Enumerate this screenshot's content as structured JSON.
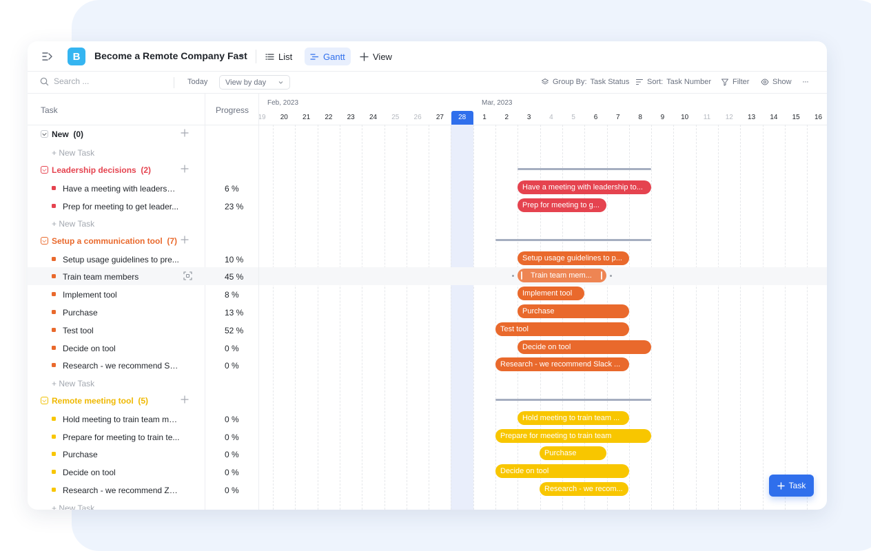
{
  "header": {
    "project_initial": "B",
    "project_title": "Become a Remote Company Fast",
    "views": {
      "list": "List",
      "gantt": "Gantt",
      "add": "View"
    }
  },
  "toolbar": {
    "search_placeholder": "Search ...",
    "today": "Today",
    "view_by": "View by day",
    "group_by_label": "Group By:",
    "group_by_value": "Task Status",
    "sort_label": "Sort:",
    "sort_value": "Task Number",
    "filter": "Filter",
    "show": "Show",
    "more": "···"
  },
  "columns": {
    "task": "Task",
    "progress": "Progress"
  },
  "timeline": {
    "months": [
      "Feb, 2023",
      "Mar, 2023"
    ],
    "days": [
      "19",
      "20",
      "21",
      "22",
      "23",
      "24",
      "25",
      "26",
      "27",
      "28",
      "1",
      "2",
      "3",
      "4",
      "5",
      "6",
      "7",
      "8",
      "9",
      "10",
      "11",
      "12",
      "13",
      "14",
      "15",
      "16"
    ],
    "weekend_days": [
      "19",
      "25",
      "26",
      "4",
      "5",
      "11",
      "12"
    ],
    "today": "28"
  },
  "colors": {
    "red": "#e5434f",
    "orange": "#e9692c",
    "yellow": "#f8c600",
    "today": "#2f6fec"
  },
  "groups": {
    "new": {
      "name": "New",
      "count": "(0)",
      "new_task": "+ New Task"
    },
    "leadership": {
      "name": "Leadership decisions",
      "count": "(2)",
      "new_task": "+ New Task",
      "tasks": [
        {
          "name": "Have a meeting with leadershi...",
          "progress": "6 %",
          "bar": "Have a meeting with leadership to..."
        },
        {
          "name": "Prep for meeting to get leader...",
          "progress": "23 %",
          "bar": "Prep for meeting to g..."
        }
      ]
    },
    "setup": {
      "name": "Setup a communication tool",
      "count": "(7)",
      "new_task": "+ New Task",
      "tasks": [
        {
          "name": "Setup usage guidelines to pre...",
          "progress": "10 %",
          "bar": "Setup usage guidelines to p..."
        },
        {
          "name": "Train team members",
          "progress": "45 %",
          "bar": "Train team mem..."
        },
        {
          "name": "Implement tool",
          "progress": "8 %",
          "bar": "Implement tool"
        },
        {
          "name": "Purchase",
          "progress": "13 %",
          "bar": "Purchase"
        },
        {
          "name": "Test tool",
          "progress": "52 %",
          "bar": "Test tool"
        },
        {
          "name": "Decide on tool",
          "progress": "0 %",
          "bar": "Decide on tool"
        },
        {
          "name": "Research - we recommend Sla...",
          "progress": "0 %",
          "bar": "Research - we recommend Slack ..."
        }
      ]
    },
    "remote": {
      "name": "Remote meeting tool",
      "count": "(5)",
      "new_task": "+ New Task",
      "tasks": [
        {
          "name": "Hold meeting to train team me...",
          "progress": "0 %",
          "bar": "Hold meeting to train team ..."
        },
        {
          "name": "Prepare for meeting to train te...",
          "progress": "0 %",
          "bar": "Prepare for meeting to train team"
        },
        {
          "name": "Purchase",
          "progress": "0 %",
          "bar": "Purchase"
        },
        {
          "name": "Decide on tool",
          "progress": "0 %",
          "bar": "Decide on tool"
        },
        {
          "name": "Research - we recommend Zo...",
          "progress": "0 %",
          "bar": "Research - we recom..."
        }
      ]
    }
  },
  "fab": {
    "label": "Task"
  }
}
